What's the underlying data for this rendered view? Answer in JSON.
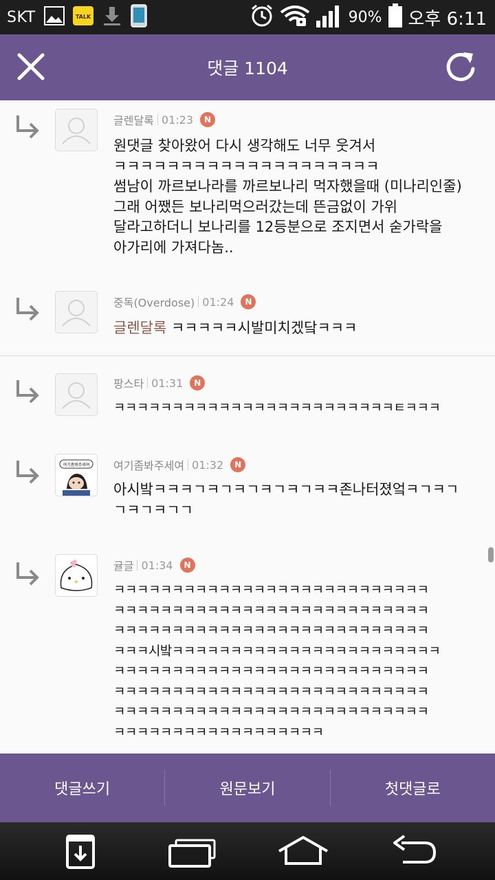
{
  "status_bar": {
    "carrier": "SKT",
    "battery": "90%",
    "time": "오후 6:11",
    "icons": [
      "gallery-icon",
      "kakaotalk-icon",
      "download-icon",
      "phone-icon",
      "alarm-icon",
      "wifi-icon",
      "signal-icon",
      "battery-icon"
    ],
    "kakao_label": "TALK"
  },
  "header": {
    "title": "댓글 1104",
    "close_icon": "close-icon",
    "refresh_icon": "refresh-icon"
  },
  "comments": [
    {
      "author": "글렌달록",
      "time": "01:23",
      "badge": "N",
      "avatar": "default-avatar",
      "body": "원댓글 찾아왔어 다시 생각해도 너무 웃겨서\nㅋㅋㅋㅋㅋㅋㅋㅋㅋㅋㅋㅋㅋㅋㅋㅋㅋㅋㅋㅋ\n썸남이 까르보나라를 까르보나리 먹자했을때 (미나리인줄)\n그래 어쨌든 보나리먹으러갔는데 뜬금없이 가위\n달라고하더니 보나리를 12등분으로 조지면서 숟가락을\n아가리에 가져다놈.."
    },
    {
      "author": "중독(Overdose)",
      "time": "01:24",
      "badge": "N",
      "avatar": "default-avatar",
      "mention": "글렌달록",
      "body": " ㅋㅋㅋㅋㅋ시발미치겠닼ㅋㅋㅋ"
    },
    {
      "author": "팡스타",
      "time": "01:31",
      "badge": "N",
      "avatar": "default-avatar",
      "body": "ㅋㅋㅋㅋㅋㅋㅋㅋㅋㅋㅋㅋㅋㅋㅋㅋㅋㅋㅋㅋㅋㅋㅋㅋㅌㅋㅋㅋ"
    },
    {
      "author": "여기좀봐주세여",
      "time": "01:32",
      "badge": "N",
      "avatar": "cartoon-avatar",
      "avatar_text": "여기좀봐주세여",
      "body": "아시밬ㅋㅋㅋㄱㅋㄱㅋㄱㅋㄱㅋㄱㅋㅋ존나터졌엌ㅋㄱㅋㄱ\nㄱㅋㄱㅋㄱㄱ"
    },
    {
      "author": "귤글",
      "time": "01:34",
      "badge": "N",
      "avatar": "chick-avatar",
      "body": "ㅋㅋㅋㅋㅋㅋㅋㅋㅋㅋㅋㅋㅋㅋㅋㅋㅋㅋㅋㅋㅋㅋㅋㅋㅋㅋㅋ\nㅋㅋㅋㅋㅋㅋㅋㅋㅋㅋㅋㅋㅋㅋㅋㅋㅋㅋㅋㅋㅋㅋㅋㅋㅋㅋㅋ\nㅋㅋㅋㅋㅋㅋㅋㅋㅋㅋㅋㅋㅋㅋㅋㅋㅋㅋㅋㅋㅋㅋㅋㅋㅋㅋㅋ\nㅋㅋㅋ시밬ㅋㅋㅋㅋㅋㅋㅋㅋㅋㅋㅋㅋㅋㅋㅋㅋㅋㅋㅋㅋㅋㅋㅋ\nㅋㅋㅋㅋㅋㅋㅋㅋㅋㅋㅋㅋㅋㅋㅋㅋㅋㅋㅋㅋㅋㅋㅋㅋㅋㅋㅋ\nㅋㅋㅋㅋㅋㅋㅋㅋㅋㅋㅋㅋㅋㅋㅋㅋㅋㅋㅋㅋㅋㅋㅋㅋㅋㅋㅋ\nㅋㅋㅋㅋㅋㅋㅋㅋㅋㅋㅋㅋㅋㅋㅋㅋㅋㅋㅋㅋㅋㅋㅋㅋㅋㅋㅋ\nㅋㅋㅋㅋㅋㅋㅋㅋㅋㅋㅋㅋㅋㅋㅋㅋㅋㅋ"
    }
  ],
  "actions": {
    "write_comment": "댓글쓰기",
    "view_original": "원문보기",
    "first_comment": "첫댓글로"
  },
  "nav": {
    "icons": [
      "app-drawer-icon",
      "recent-apps-icon",
      "home-icon",
      "back-icon"
    ]
  },
  "colors": {
    "brand": "#6b5690",
    "badge": "#e0735a",
    "mention": "#8a5a4a"
  }
}
